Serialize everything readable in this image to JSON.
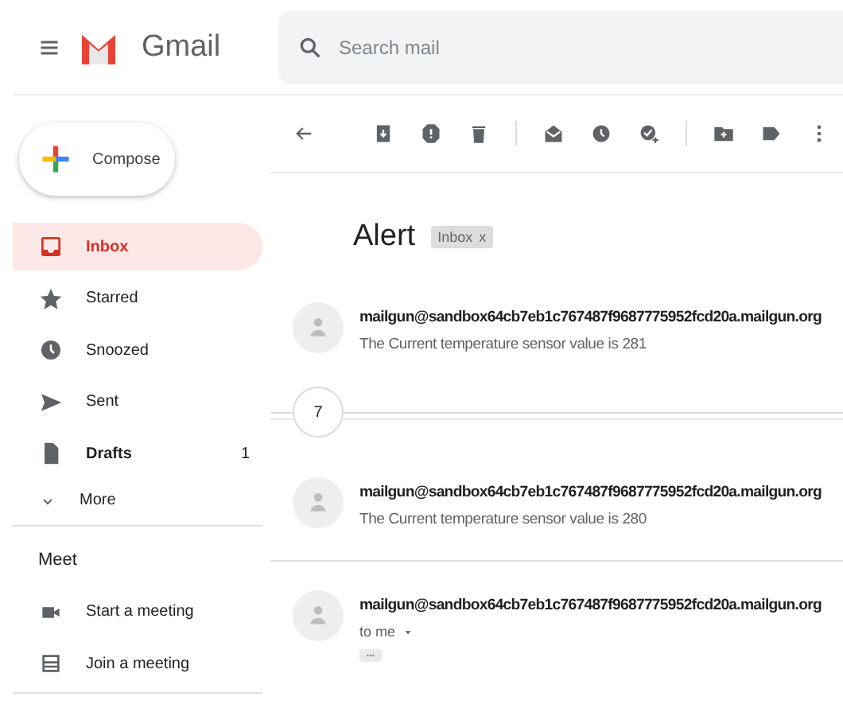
{
  "header": {
    "app_name": "Gmail",
    "search": {
      "placeholder": "Search mail"
    }
  },
  "sidebar": {
    "compose": "Compose",
    "folders": [
      {
        "kind": "inbox",
        "label": "Inbox",
        "selected": true,
        "unread": true
      },
      {
        "kind": "starred",
        "label": "Starred",
        "selected": false,
        "unread": false
      },
      {
        "kind": "snoozed",
        "label": "Snoozed",
        "selected": false,
        "unread": false
      },
      {
        "kind": "sent",
        "label": "Sent",
        "selected": false,
        "unread": false
      },
      {
        "kind": "drafts",
        "label": "Drafts",
        "selected": false,
        "unread": true,
        "count": "1"
      },
      {
        "kind": "more",
        "label": "More",
        "selected": false,
        "unread": false
      }
    ],
    "meet": {
      "title": "Meet",
      "items": [
        {
          "kind": "video",
          "label": "Start a meeting"
        },
        {
          "kind": "keyboard",
          "label": "Join a meeting"
        }
      ]
    }
  },
  "thread": {
    "subject": "Alert",
    "labels": [
      {
        "text": "Inbox",
        "close": "x"
      }
    ],
    "messages": [
      {
        "kind": "collapsed",
        "sender": "mailgun@sandbox64cb7eb1c767487f9687775952fcd20a.mailgun.org",
        "snippet": "The Current temperature sensor value is 281"
      },
      {
        "kind": "hidden-count",
        "count": "7"
      },
      {
        "kind": "collapsed",
        "sender": "mailgun@sandbox64cb7eb1c767487f9687775952fcd20a.mailgun.org",
        "snippet": "The Current temperature sensor value is 280"
      },
      {
        "kind": "expanded",
        "sender": "mailgun@sandbox64cb7eb1c767487f9687775952fcd20a.mailgun.org",
        "recipient": "to me"
      }
    ]
  }
}
